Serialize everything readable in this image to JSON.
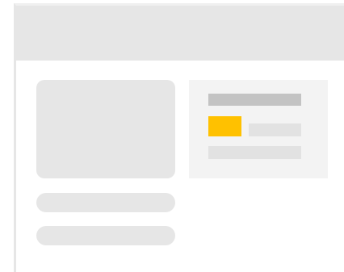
{
  "ui": {
    "state": "loading-skeleton",
    "colors": {
      "placeholder": "#e6e6e6",
      "panel_background": "#f3f3f3",
      "title_placeholder": "#c3c3c3",
      "accent": "#ffc100",
      "line_placeholder": "#e2e2e2"
    },
    "icons": []
  }
}
